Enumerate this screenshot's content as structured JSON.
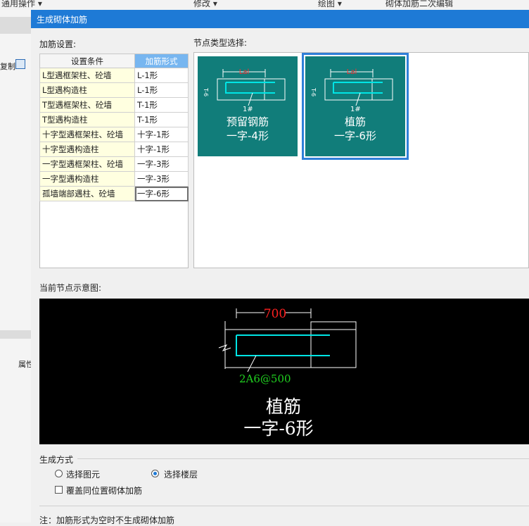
{
  "app": {
    "toolbar": [
      "通用操作 ▾",
      "修改 ▾",
      "绘图 ▾",
      "砌体加筋二次编辑"
    ],
    "left_labels": [
      "复制",
      "属性"
    ]
  },
  "dialog": {
    "title": "生成砌体加筋",
    "settings_label": "加筋设置:",
    "node_type_label": "节点类型选择:",
    "table": {
      "headers": [
        "设置条件",
        "加筋形式"
      ],
      "rows": [
        {
          "cond": "L型遇框架柱、砼墙",
          "val": "L-1形"
        },
        {
          "cond": "L型遇构造柱",
          "val": "L-1形"
        },
        {
          "cond": "T型遇框架柱、砼墙",
          "val": "T-1形"
        },
        {
          "cond": "T型遇构造柱",
          "val": "T-1形"
        },
        {
          "cond": "十字型遇框架柱、砼墙",
          "val": "十字-1形"
        },
        {
          "cond": "十字型遇构造柱",
          "val": "十字-1形"
        },
        {
          "cond": "一字型遇框架柱、砼墙",
          "val": "一字-3形"
        },
        {
          "cond": "一字型遇构造柱",
          "val": "一字-3形"
        },
        {
          "cond": "孤墙端部遇柱、砼墙",
          "val": "一字-6形"
        }
      ]
    },
    "nodes": [
      {
        "line1": "预留钢筋",
        "line2": "一字-4形",
        "dim": "Lal",
        "side": "T-6",
        "bar": "1#"
      },
      {
        "line1": "植筋",
        "line2": "一字-6形",
        "dim": "Lal",
        "side": "T-6",
        "bar": "1#"
      }
    ],
    "preview_label": "当前节点示意图:",
    "preview": {
      "dim": "700",
      "rebar": "2A6@500",
      "line1": "植筋",
      "line2": "一字-6形"
    },
    "gen_method_label": "生成方式",
    "radio_elem": "选择图元",
    "radio_floor": "选择楼层",
    "checkbox_label": "覆盖同位置砌体加筋",
    "note": "注：加筋形式为空时不生成砌体加筋"
  },
  "colors": {
    "title_bar": "#1e7ad6",
    "node_card": "#117d7a",
    "header_highlight": "#77b6f0",
    "cond_cell": "#ffffe0",
    "cad_cyan": "#00ffff",
    "cad_red": "#ff2020",
    "cad_green": "#20d020"
  }
}
